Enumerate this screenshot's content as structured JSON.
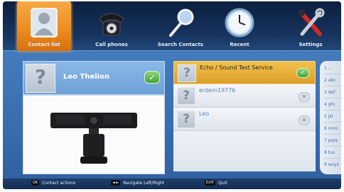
{
  "nav": {
    "items": [
      {
        "label": "Contact list",
        "icon": "contact-list-icon",
        "active": true
      },
      {
        "label": "Call phones",
        "icon": "telephone-icon"
      },
      {
        "label": "Search Contacts",
        "icon": "magnifier-icon"
      },
      {
        "label": "Recent",
        "icon": "clock-icon"
      },
      {
        "label": "Settings",
        "icon": "tools-icon"
      }
    ]
  },
  "selected_contact": {
    "name": "Leo Thelion",
    "status": "online"
  },
  "contacts": [
    {
      "name": "Echo / Sound Test Service",
      "status": "online",
      "selected": true
    },
    {
      "name": "erdem19776",
      "status": "offline"
    },
    {
      "name": "Leo",
      "status": "offline"
    }
  ],
  "alphabet": [
    "1 ...",
    "2 abc",
    "3 def",
    "4 ghi",
    "5 jkl",
    "6 mno",
    "7 pqrs",
    "8 tuv",
    "9 wxyz"
  ],
  "footer": {
    "hints": [
      {
        "key": "OK",
        "label": "Contact actions"
      },
      {
        "key": "◄ ►",
        "label": "Navigate Left/Right"
      },
      {
        "key": "EXIT",
        "label": "Quit"
      }
    ]
  },
  "colors": {
    "accent_orange": "#ec8a1e",
    "selection_yellow": "#f3c14a",
    "background_blue": "#3a70b2",
    "online_green": "#46a536"
  }
}
